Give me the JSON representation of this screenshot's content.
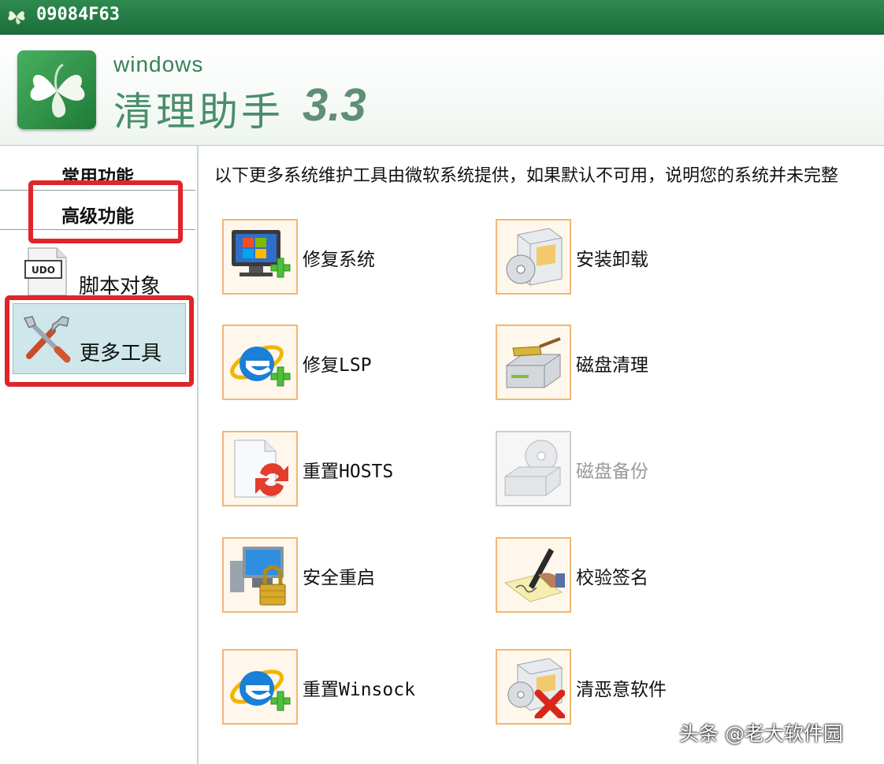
{
  "window": {
    "title": "09084F63"
  },
  "brand": {
    "sub": "windows",
    "main": "清理助手",
    "version": "3.3"
  },
  "sidebar": {
    "tabs": [
      {
        "label": "常用功能"
      },
      {
        "label": "高级功能"
      }
    ],
    "items": [
      {
        "label": "脚本对象",
        "icon": "script-icon"
      },
      {
        "label": "更多工具",
        "icon": "tools-icon"
      }
    ]
  },
  "main": {
    "notice": "以下更多系统维护工具由微软系统提供，如果默认不可用，说明您的系统并未完整",
    "tools_left": [
      {
        "label": "修复系统",
        "icon": "monitor-plus-icon"
      },
      {
        "label": "修复LSP",
        "icon": "ie-plus-icon"
      },
      {
        "label": "重置HOSTS",
        "icon": "document-refresh-icon"
      },
      {
        "label": "安全重启",
        "icon": "computer-lock-icon"
      },
      {
        "label": "重置Winsock",
        "icon": "ie-plus-icon"
      }
    ],
    "tools_right": [
      {
        "label": "安装卸载",
        "icon": "install-box-icon"
      },
      {
        "label": "磁盘清理",
        "icon": "disk-broom-icon"
      },
      {
        "label": "磁盘备份",
        "icon": "disk-backup-icon",
        "disabled": true
      },
      {
        "label": "校验签名",
        "icon": "pen-sign-icon"
      },
      {
        "label": "清恶意软件",
        "icon": "box-cross-icon"
      }
    ]
  },
  "watermark": "头条 @老大软件园",
  "colors": {
    "titlebar": "#1c6f3a",
    "highlight": "#e0242b",
    "icon_border": "#f0b774",
    "selected_item": "#cfe7ea"
  }
}
